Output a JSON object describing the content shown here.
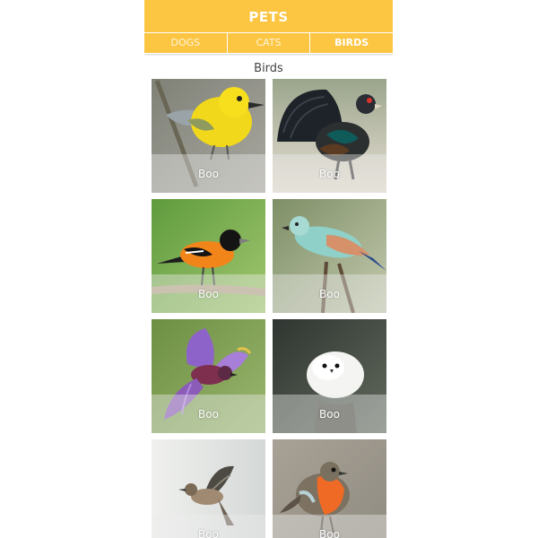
{
  "app": {
    "title": "PETS"
  },
  "tabs": [
    {
      "label": "DOGS"
    },
    {
      "label": "CATS"
    },
    {
      "label": "BIRDS",
      "active": true
    }
  ],
  "section": {
    "title": "Birds"
  },
  "cards": [
    {
      "name": "Boo",
      "subject": "yellow warbler on branch"
    },
    {
      "name": "Boo",
      "subject": "capercaillie displaying fanned tail"
    },
    {
      "name": "Boo",
      "subject": "baltimore oriole perched"
    },
    {
      "name": "Boo",
      "subject": "european roller on branch"
    },
    {
      "name": "Boo",
      "subject": "purple bird in flight"
    },
    {
      "name": "Boo",
      "subject": "white long-tailed tit"
    },
    {
      "name": "Boo",
      "subject": "small sparrow landing"
    },
    {
      "name": "Boo",
      "subject": "european robin"
    }
  ],
  "colors": {
    "accent": "#fcc542",
    "tab_text": "#fff6dc",
    "caption_overlay": "rgba(235,235,235,0.42)"
  }
}
